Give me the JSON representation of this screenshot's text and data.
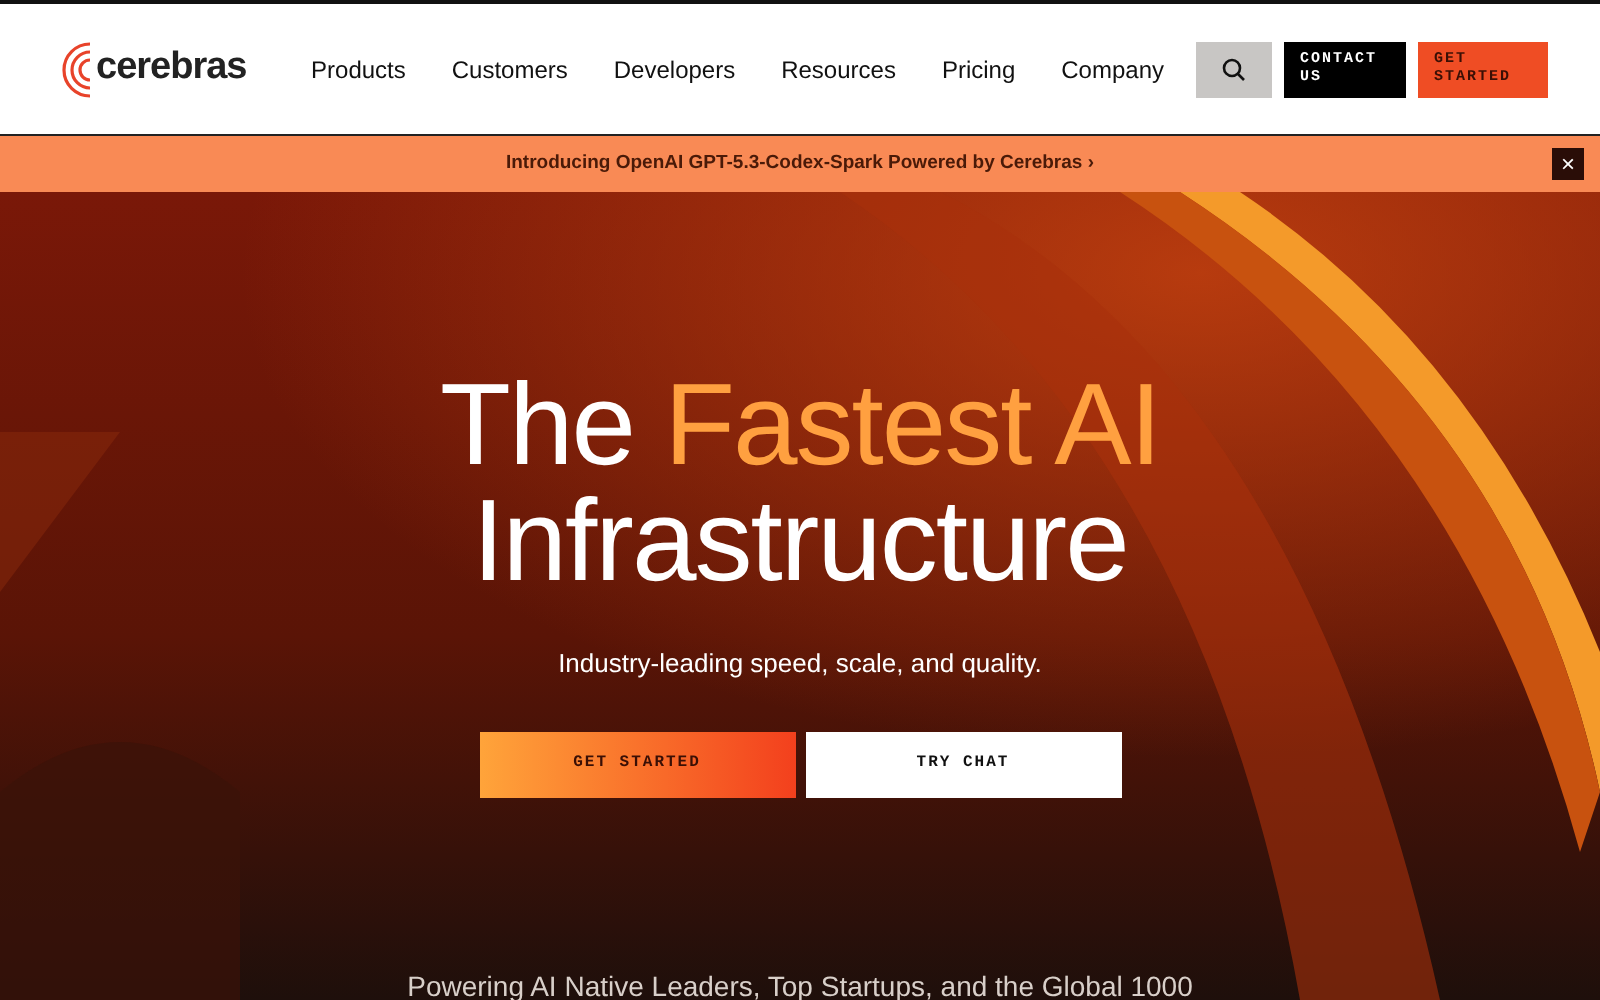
{
  "logo": {
    "text": "cerebras"
  },
  "nav": {
    "items": [
      "Products",
      "Customers",
      "Developers",
      "Resources",
      "Pricing",
      "Company"
    ],
    "buttons": [
      {
        "kind": "search"
      },
      {
        "kind": "dark",
        "label": "CONTACT US"
      },
      {
        "kind": "accent",
        "label": "GET STARTED"
      }
    ]
  },
  "banner": {
    "text": "Introducing OpenAI GPT-5.3-Codex-Spark Powered by Cerebras ›",
    "close": "×"
  },
  "hero": {
    "kind": "picture",
    "headline": [
      {
        "text": "The ",
        "highlight": false
      },
      {
        "text": "Fastest AI",
        "highlight": true
      },
      {
        "text": " Infrastructure",
        "highlight": false
      }
    ],
    "subtitle": "Industry-leading speed, scale, and quality.",
    "buttons": [
      {
        "kind": "gradient",
        "label": "GET STARTED"
      },
      {
        "kind": "light",
        "label": "TRY CHAT"
      }
    ],
    "footnote": "Powering AI Native Leaders, Top Startups, and the Global 1000"
  }
}
